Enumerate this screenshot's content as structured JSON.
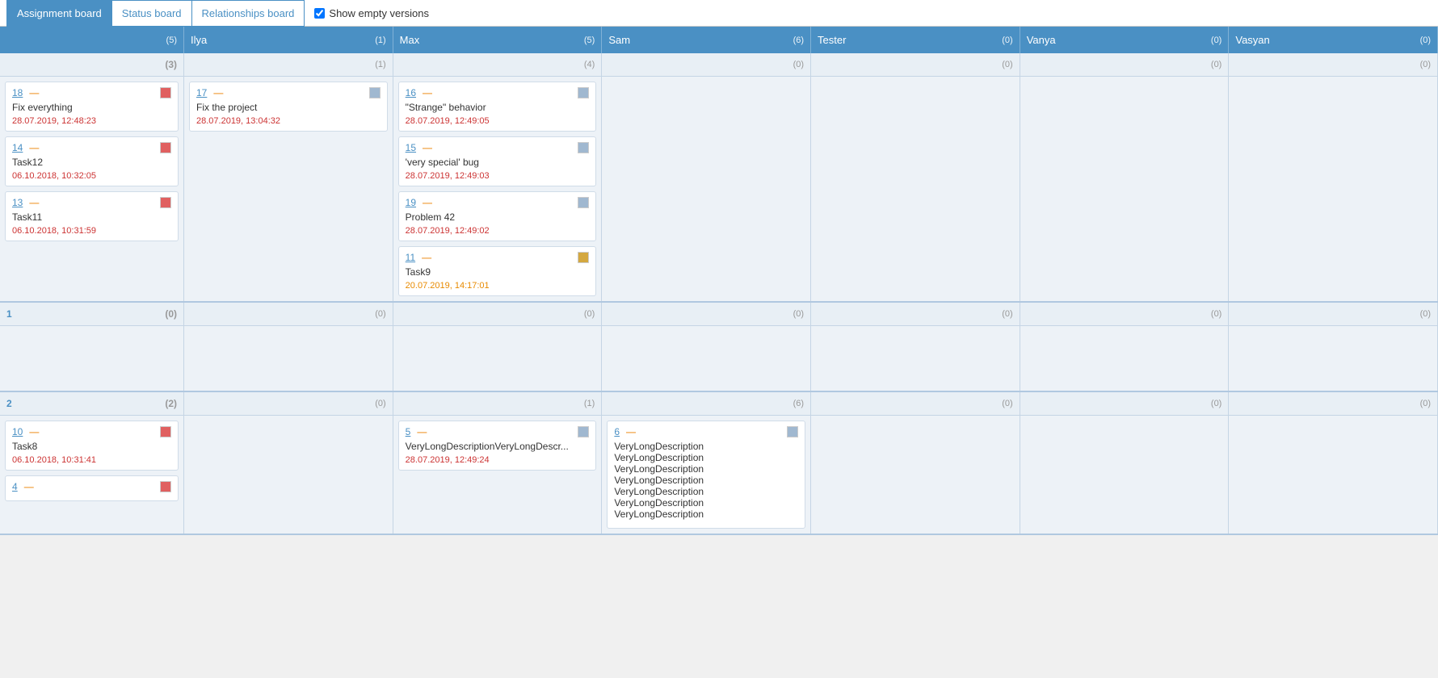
{
  "tabs": [
    {
      "id": "assignment",
      "label": "Assignment board",
      "active": true
    },
    {
      "id": "status",
      "label": "Status board",
      "active": false
    },
    {
      "id": "relationships",
      "label": "Relationships board",
      "active": false
    }
  ],
  "show_empty_label": "Show empty versions",
  "show_empty_checked": true,
  "columns": [
    {
      "id": "unassigned",
      "label": "",
      "count": "(5)"
    },
    {
      "id": "ilya",
      "label": "Ilya",
      "count": "(1)"
    },
    {
      "id": "max",
      "label": "Max",
      "count": "(5)"
    },
    {
      "id": "sam",
      "label": "Sam",
      "count": "(6)"
    },
    {
      "id": "tester",
      "label": "Tester",
      "count": "(0)"
    },
    {
      "id": "vanya",
      "label": "Vanya",
      "count": "(0)"
    },
    {
      "id": "vasyan",
      "label": "Vasyan",
      "count": "(0)"
    }
  ],
  "versions": [
    {
      "id": "none",
      "label": "",
      "cells": [
        {
          "col": "unassigned",
          "count": "(3)",
          "cards": [
            {
              "id": "18",
              "color": "#e06060",
              "title": "Fix everything",
              "date": "28.07.2019, 12:48:23",
              "date_color": "red"
            },
            {
              "id": "14",
              "color": "#e06060",
              "title": "Task12",
              "date": "06.10.2018, 10:32:05",
              "date_color": "red"
            },
            {
              "id": "13",
              "color": "#e06060",
              "title": "Task11",
              "date": "06.10.2018, 10:31:59",
              "date_color": "red"
            }
          ]
        },
        {
          "col": "ilya",
          "count": "(1)",
          "cards": [
            {
              "id": "17",
              "color": "#a0b8d0",
              "title": "Fix the project",
              "date": "28.07.2019, 13:04:32",
              "date_color": "red"
            }
          ]
        },
        {
          "col": "max",
          "count": "(4)",
          "cards": [
            {
              "id": "16",
              "color": "#a0b8d0",
              "title": "\"Strange\" behavior",
              "date": "28.07.2019, 12:49:05",
              "date_color": "red"
            },
            {
              "id": "15",
              "color": "#a0b8d0",
              "title": "'very special' bug",
              "date": "28.07.2019, 12:49:03",
              "date_color": "red"
            },
            {
              "id": "19",
              "color": "#a0b8d0",
              "title": "Problem 42",
              "date": "28.07.2019, 12:49:02",
              "date_color": "red"
            },
            {
              "id": "11",
              "color": "#d4a840",
              "title": "Task9",
              "date": "20.07.2019, 14:17:01",
              "date_color": "orange"
            }
          ]
        },
        {
          "col": "sam",
          "count": "(0)",
          "cards": []
        },
        {
          "col": "tester",
          "count": "(0)",
          "cards": []
        },
        {
          "col": "vanya",
          "count": "(0)",
          "cards": []
        },
        {
          "col": "vasyan",
          "count": "(0)",
          "cards": []
        }
      ]
    },
    {
      "id": "1",
      "label": "1",
      "cells": [
        {
          "col": "unassigned",
          "count": "(0)",
          "cards": []
        },
        {
          "col": "ilya",
          "count": "(0)",
          "cards": []
        },
        {
          "col": "max",
          "count": "(0)",
          "cards": []
        },
        {
          "col": "sam",
          "count": "(0)",
          "cards": []
        },
        {
          "col": "tester",
          "count": "(0)",
          "cards": []
        },
        {
          "col": "vanya",
          "count": "(0)",
          "cards": []
        },
        {
          "col": "vasyan",
          "count": "(0)",
          "cards": []
        }
      ]
    },
    {
      "id": "2",
      "label": "2",
      "cells": [
        {
          "col": "unassigned",
          "count": "(2)",
          "cards": [
            {
              "id": "10",
              "color": "#e06060",
              "title": "Task8",
              "date": "06.10.2018, 10:31:41",
              "date_color": "red"
            },
            {
              "id": "4",
              "color": "#e06060",
              "title": "",
              "date": "",
              "date_color": "red"
            }
          ]
        },
        {
          "col": "ilya",
          "count": "(0)",
          "cards": []
        },
        {
          "col": "max",
          "count": "(1)",
          "cards": [
            {
              "id": "5",
              "color": "#a0b8d0",
              "title": "VeryLongDescriptionVeryLongDescr...",
              "date": "28.07.2019, 12:49:24",
              "date_color": "red"
            }
          ]
        },
        {
          "col": "sam",
          "count": "(6)",
          "cards": [
            {
              "id": "6",
              "color": "#a0b8d0",
              "title": "VeryLongDescription\nVeryLongDescription\nVeryLongDescription\nVeryLongDescription\nVeryLongDescription\nVeryLongDescription\nVeryLongDescription",
              "date": "",
              "date_color": "red"
            }
          ]
        },
        {
          "col": "tester",
          "count": "(0)",
          "cards": []
        },
        {
          "col": "vanya",
          "count": "(0)",
          "cards": []
        },
        {
          "col": "vasyan",
          "count": "(0)",
          "cards": []
        }
      ]
    }
  ],
  "colors": {
    "red_card": "#e06060",
    "blue_card": "#a0b8d0",
    "orange_card": "#d4a840",
    "header_bg": "#4a90c4"
  }
}
